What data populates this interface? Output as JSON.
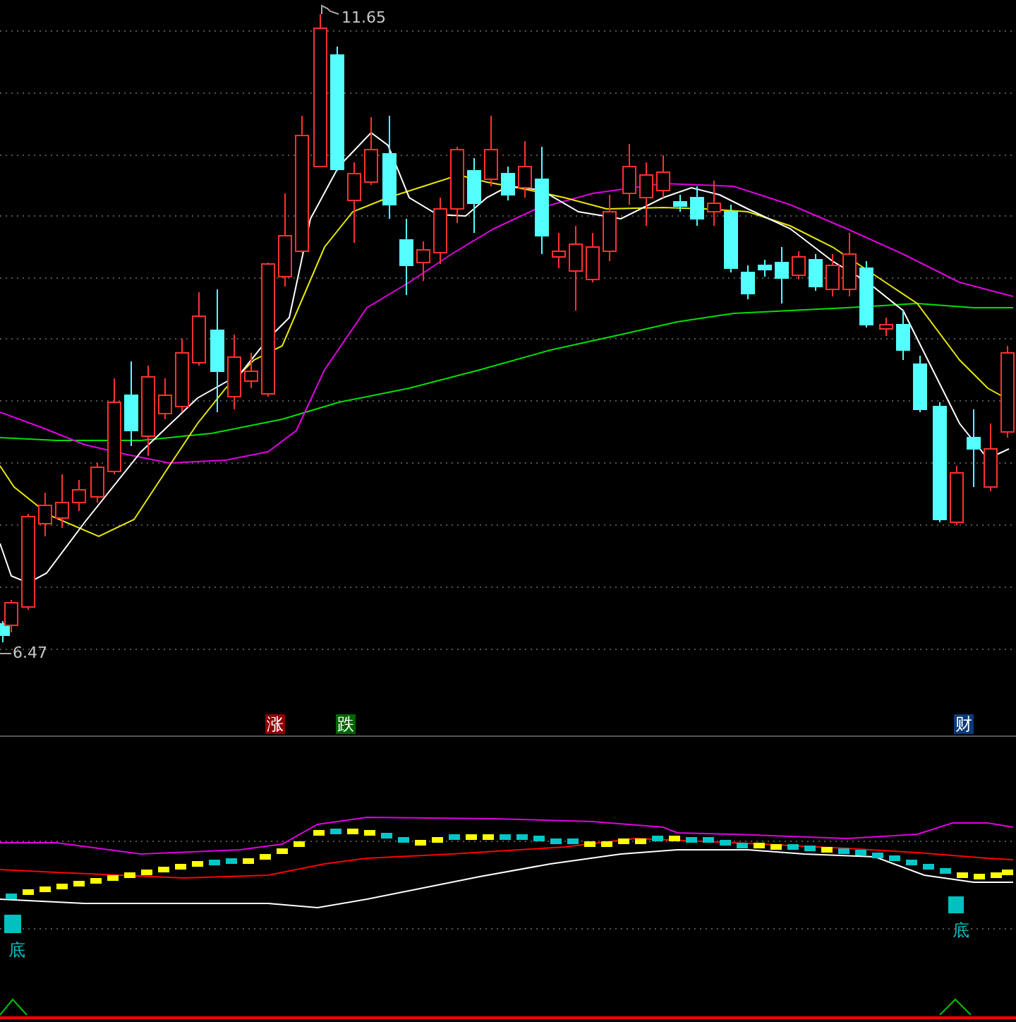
{
  "main_chart": {
    "high_label": "11.65",
    "low_label": "6.47"
  },
  "signals": [
    {
      "text": "涨",
      "color": "#8b0000"
    },
    {
      "text": "跌",
      "color": "#006400"
    },
    {
      "text": "财",
      "color": "#0a3a7a"
    }
  ],
  "indicator": {
    "bottom_marks": [
      {
        "text": "底"
      },
      {
        "text": "底"
      }
    ]
  }
}
